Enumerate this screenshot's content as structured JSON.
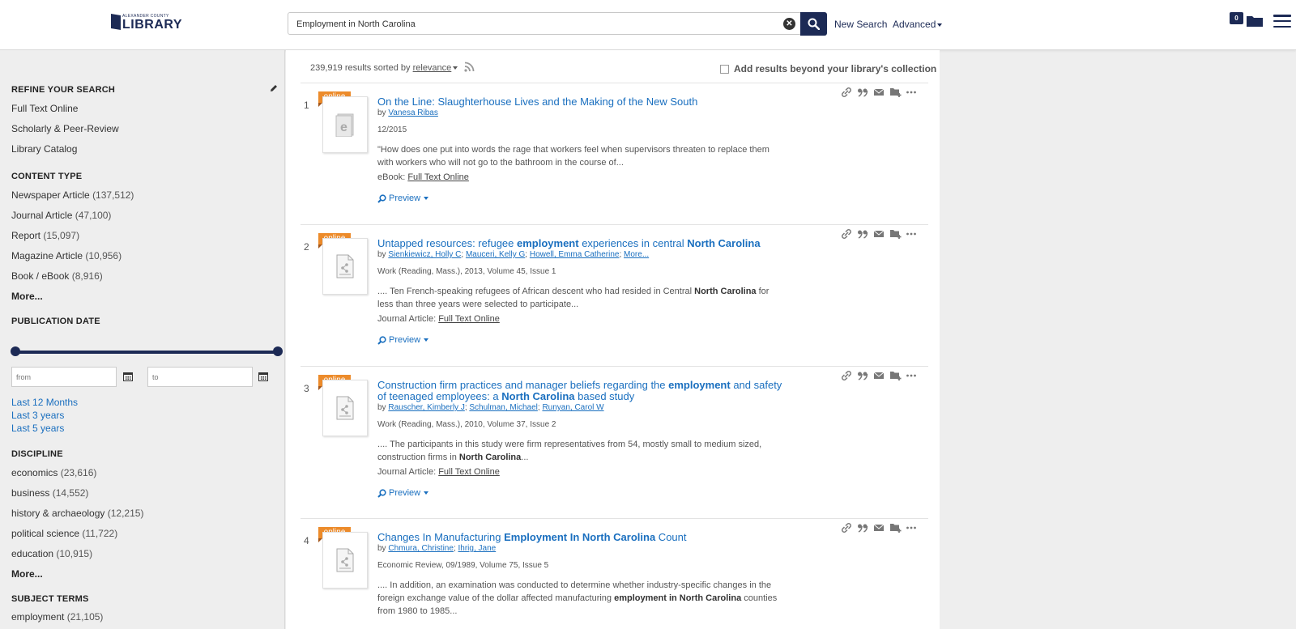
{
  "header": {
    "logo_top": "ALEXANDER COUNTY",
    "logo_main": "LIBRARY",
    "search_value": "Employment in North Carolina",
    "new_search": "New Search",
    "advanced": "Advanced",
    "folder_count": "0"
  },
  "sidebar": {
    "refine_title": "REFINE YOUR SEARCH",
    "refine_items": [
      "Full Text Online",
      "Scholarly & Peer-Review",
      "Library Catalog"
    ],
    "content_type_title": "CONTENT TYPE",
    "content_types": [
      {
        "label": "Newspaper Article",
        "count": "(137,512)"
      },
      {
        "label": "Journal Article",
        "count": "(47,100)"
      },
      {
        "label": "Report",
        "count": "(15,097)"
      },
      {
        "label": "Magazine Article",
        "count": "(10,956)"
      },
      {
        "label": "Book / eBook",
        "count": "(8,916)"
      }
    ],
    "more_label": "More...",
    "pub_date_title": "PUBLICATION DATE",
    "from_placeholder": "from",
    "to_placeholder": "to",
    "date_links": [
      "Last 12 Months",
      "Last 3 years",
      "Last 5 years"
    ],
    "discipline_title": "DISCIPLINE",
    "disciplines": [
      {
        "label": "economics",
        "count": "(23,616)"
      },
      {
        "label": "business",
        "count": "(14,552)"
      },
      {
        "label": "history & archaeology",
        "count": "(12,215)"
      },
      {
        "label": "political science",
        "count": "(11,722)"
      },
      {
        "label": "education",
        "count": "(10,915)"
      }
    ],
    "subject_terms_title": "SUBJECT TERMS",
    "subject_terms_first": {
      "label": "employment",
      "count": "(21,105)"
    }
  },
  "results_header": {
    "count_text": "239,919 results sorted by",
    "sort_label": "relevance",
    "add_beyond": "Add results beyond your library's collection"
  },
  "results": [
    {
      "num": "1",
      "badge": "online",
      "title_parts": [
        [
          "On the Line: Slaughterhouse Lives and the Making of the New South",
          false
        ]
      ],
      "by": "by",
      "authors": [
        "Vanesa Ribas"
      ],
      "pub": "12/2015",
      "snippet_parts": [
        [
          "\"How does one put into words the rage that workers feel when supervisors threaten to replace them with workers who will not go to the bathroom in the course of...",
          false
        ]
      ],
      "format_label": "eBook:",
      "format_link": "Full Text Online",
      "preview": "Preview",
      "thumb": "ebook"
    },
    {
      "num": "2",
      "badge": "online",
      "title_parts": [
        [
          "Untapped resources: refugee ",
          false
        ],
        [
          "employment",
          true
        ],
        [
          " experiences in central ",
          false
        ],
        [
          "North Carolina",
          true
        ]
      ],
      "by": "by",
      "authors": [
        "Sienkiewicz, Holly C",
        "Mauceri, Kelly G",
        "Howell, Emma Catherine",
        "More..."
      ],
      "pub": "Work (Reading, Mass.), 2013, Volume 45, Issue 1",
      "snippet_parts": [
        [
          ".... Ten French-speaking refugees of African descent who had resided in Central ",
          false
        ],
        [
          "North Carolina",
          true
        ],
        [
          " for less than three years were selected to participate...",
          false
        ]
      ],
      "format_label": "Journal Article:",
      "format_link": "Full Text Online",
      "preview": "Preview",
      "thumb": "article"
    },
    {
      "num": "3",
      "badge": "online",
      "title_parts": [
        [
          "Construction firm practices and manager beliefs regarding the ",
          false
        ],
        [
          "employment",
          true
        ],
        [
          " and safety of teenaged employees: a ",
          false
        ],
        [
          "North Carolina",
          true
        ],
        [
          " based study",
          false
        ]
      ],
      "by": "by",
      "authors": [
        "Rauscher, Kimberly J",
        "Schulman, Michael",
        "Runyan, Carol W"
      ],
      "pub": "Work (Reading, Mass.), 2010, Volume 37, Issue 2",
      "snippet_parts": [
        [
          ".... The participants in this study were firm representatives from 54, mostly small to medium sized, construction firms in ",
          false
        ],
        [
          "North Carolina",
          true
        ],
        [
          "...",
          false
        ]
      ],
      "format_label": "Journal Article:",
      "format_link": "Full Text Online",
      "preview": "Preview",
      "thumb": "article"
    },
    {
      "num": "4",
      "badge": "online",
      "title_parts": [
        [
          "Changes In Manufacturing ",
          false
        ],
        [
          "Employment In North Carolina",
          true
        ],
        [
          " Count",
          false
        ]
      ],
      "by": "by",
      "authors": [
        "Chmura, Christine",
        "Ihrig, Jane"
      ],
      "pub": "Economic Review, 09/1989, Volume 75, Issue 5",
      "snippet_parts": [
        [
          ".... In addition, an examination was conducted to determine whether industry-specific changes in the foreign exchange value of the dollar affected manufacturing ",
          false
        ],
        [
          "employment in North Carolina",
          true
        ],
        [
          " counties from 1980 to 1985...",
          false
        ]
      ],
      "format_label": "",
      "format_link": "",
      "preview": "",
      "thumb": "article"
    }
  ],
  "colors": {
    "brand": "#1c2a55",
    "link": "#1a6fbf",
    "badge": "#ec8b2b"
  }
}
